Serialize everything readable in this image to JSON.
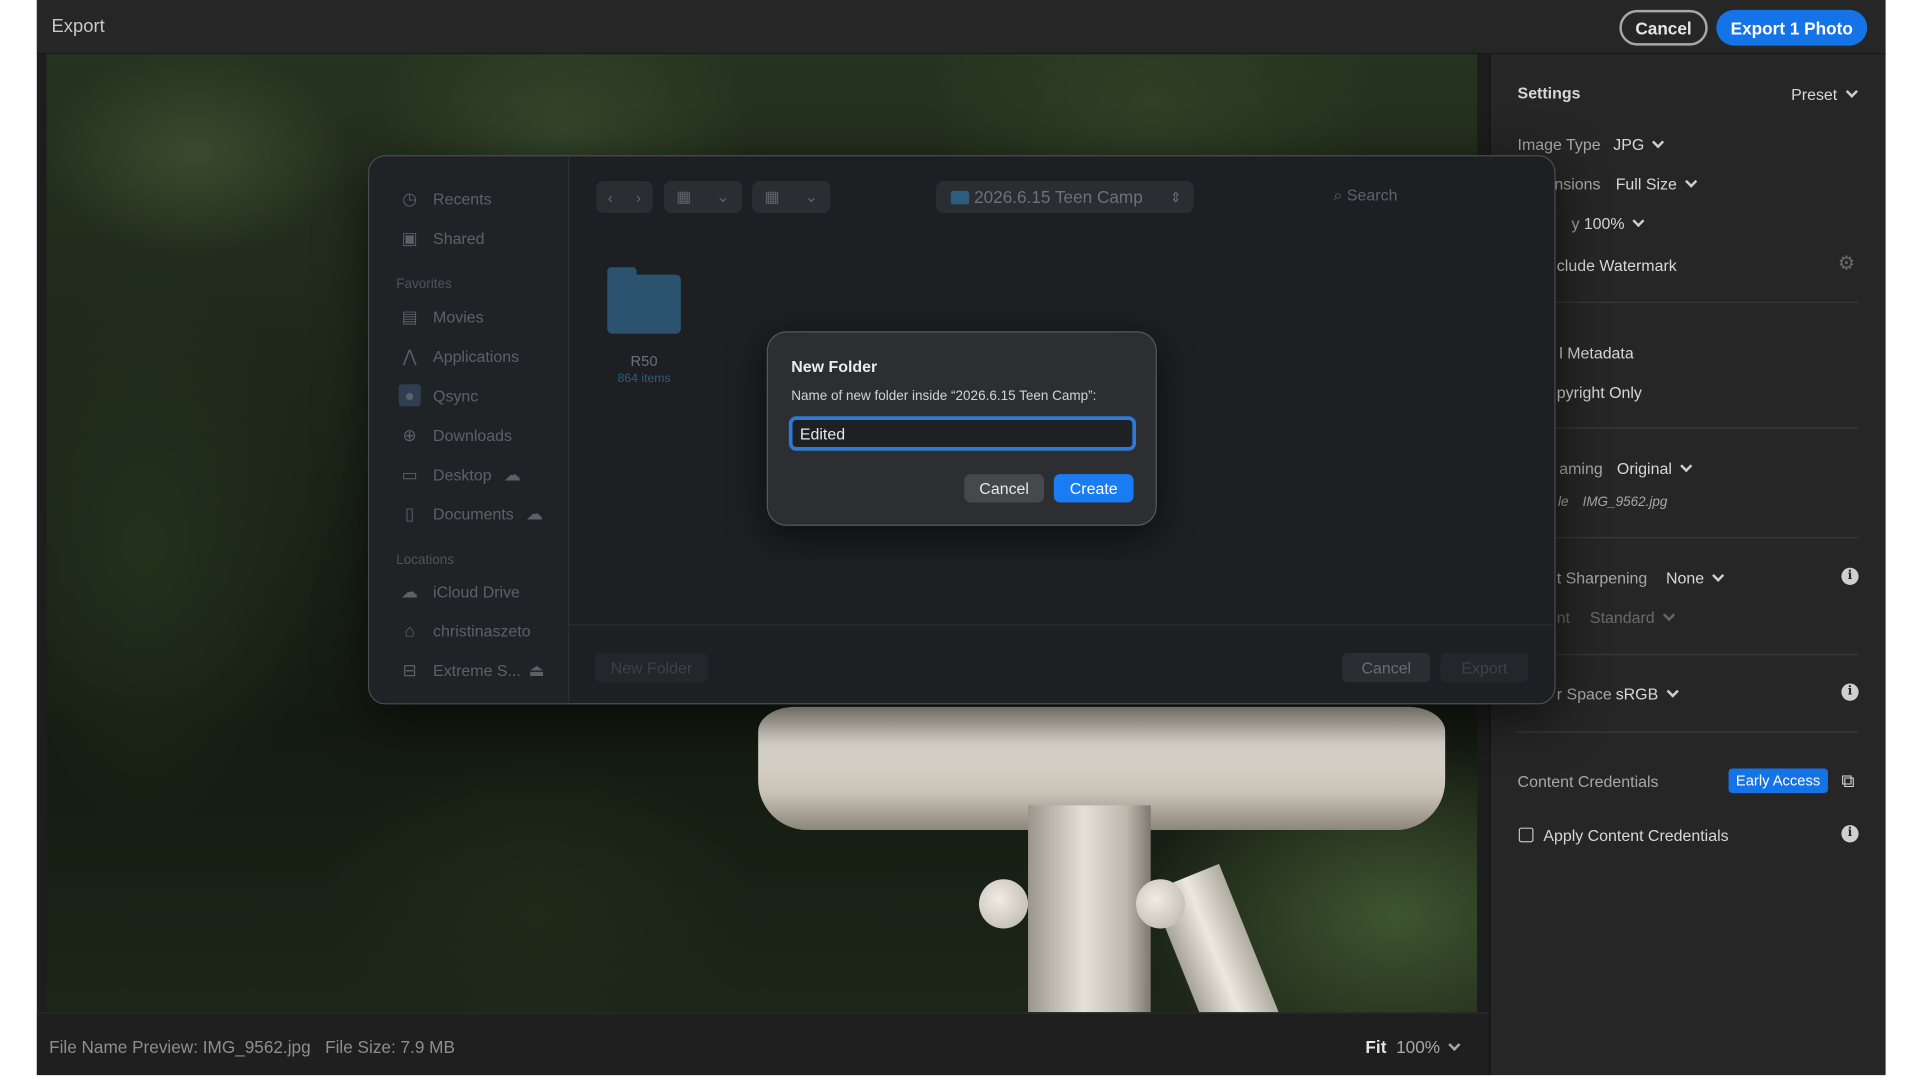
{
  "window": {
    "title": "Export"
  },
  "topbar": {
    "cancel_label": "Cancel",
    "export_label": "Export 1 Photo"
  },
  "statusbar": {
    "file_name_preview": "File Name Preview: IMG_9562.jpg",
    "file_size": "File Size: 7.9 MB",
    "fit_label": "Fit",
    "zoom": "100%"
  },
  "settings": {
    "header": "Settings",
    "preset_label": "Preset",
    "image_type_label": "Image Type",
    "image_type_value": "JPG",
    "dimensions_label": "nsions",
    "dimensions_value": "Full Size",
    "quality_label": "y",
    "quality_value": "100%",
    "watermark_label": "clude Watermark",
    "metadata_all": "l Metadata",
    "metadata_copyright": "pyright Only",
    "naming_label": "aming",
    "naming_value": "Original",
    "file_label": "le",
    "file_value": "IMG_9562.jpg",
    "sharpening_label": "t Sharpening",
    "sharpening_value": "None",
    "amount_label": "nt",
    "amount_value": "Standard",
    "colorspace_label": "r Space",
    "colorspace_value": "sRGB",
    "content_credentials_label": "Content Credentials",
    "early_access_badge": "Early Access",
    "apply_credentials_label": "Apply Content Credentials"
  },
  "save_sheet": {
    "sidebar": {
      "recents": "Recents",
      "shared": "Shared",
      "favorites_header": "Favorites",
      "movies": "Movies",
      "applications": "Applications",
      "qsync": "Qsync",
      "downloads": "Downloads",
      "desktop": "Desktop",
      "documents": "Documents",
      "locations_header": "Locations",
      "icloud": "iCloud Drive",
      "home": "christinaszeto",
      "extreme": "Extreme S..."
    },
    "location": "2026.6.15 Teen Camp",
    "search_placeholder": "Search",
    "folder_name": "R50",
    "folder_items": "864 items",
    "new_folder_button": "New Folder",
    "cancel_button": "Cancel",
    "export_button": "Export"
  },
  "new_folder_dialog": {
    "title": "New Folder",
    "description": "Name of new folder inside “2026.6.15 Teen Camp”:",
    "input_value": "Edited",
    "cancel_label": "Cancel",
    "create_label": "Create"
  }
}
